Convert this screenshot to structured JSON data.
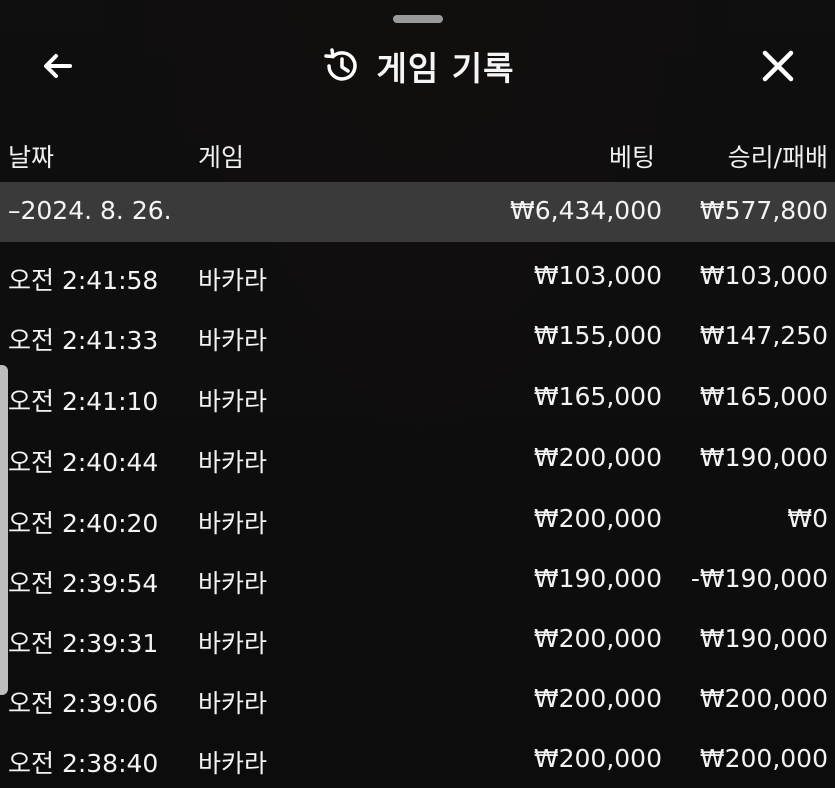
{
  "header": {
    "title": "게임 기록",
    "back_icon": "arrow-left-icon",
    "history_icon": "history-clock-icon",
    "close_icon": "close-icon"
  },
  "columns": {
    "date": "날짜",
    "game": "게임",
    "bet": "베팅",
    "win_loss": "승리/패배"
  },
  "date_group": {
    "label": "–2024. 8. 26.",
    "bet_total": "₩6,434,000",
    "win_total": "₩577,800"
  },
  "rows": [
    {
      "time": "오전 2:41:58",
      "game": "바카라",
      "bet": "₩103,000",
      "win": "₩103,000"
    },
    {
      "time": "오전 2:41:33",
      "game": "바카라",
      "bet": "₩155,000",
      "win": "₩147,250"
    },
    {
      "time": "오전 2:41:10",
      "game": "바카라",
      "bet": "₩165,000",
      "win": "₩165,000"
    },
    {
      "time": "오전 2:40:44",
      "game": "바카라",
      "bet": "₩200,000",
      "win": "₩190,000"
    },
    {
      "time": "오전 2:40:20",
      "game": "바카라",
      "bet": "₩200,000",
      "win": "₩0"
    },
    {
      "time": "오전 2:39:54",
      "game": "바카라",
      "bet": "₩190,000",
      "win": "-₩190,000"
    },
    {
      "time": "오전 2:39:31",
      "game": "바카라",
      "bet": "₩200,000",
      "win": "₩190,000"
    },
    {
      "time": "오전 2:39:06",
      "game": "바카라",
      "bet": "₩200,000",
      "win": "₩200,000"
    },
    {
      "time": "오전 2:38:40",
      "game": "바카라",
      "bet": "₩200,000",
      "win": "₩200,000"
    }
  ]
}
